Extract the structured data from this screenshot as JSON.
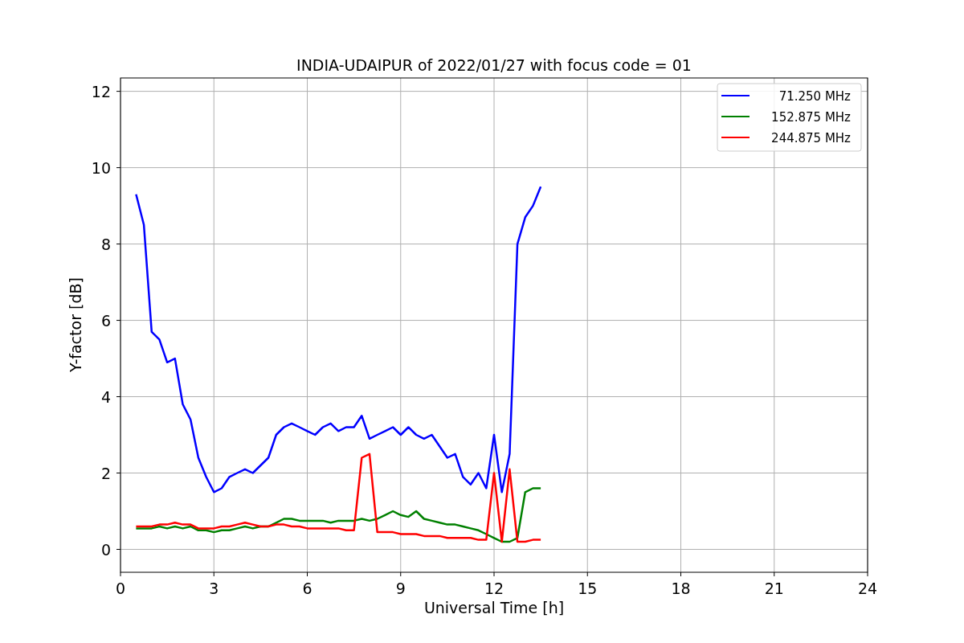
{
  "chart": {
    "chart_data": {
      "type": "line",
      "title": "INDIA-UDAIPUR of 2022/01/27 with focus code = 01",
      "xlabel": "Universal Time [h]",
      "ylabel": "Y-factor [dB]",
      "x": [
        0.5,
        0.75,
        1.0,
        1.25,
        1.5,
        1.75,
        2.0,
        2.25,
        2.5,
        2.75,
        3.0,
        3.25,
        3.5,
        3.75,
        4.0,
        4.25,
        4.5,
        4.75,
        5.0,
        5.25,
        5.5,
        5.75,
        6.0,
        6.25,
        6.5,
        6.75,
        7.0,
        7.25,
        7.5,
        7.75,
        8.0,
        8.25,
        8.5,
        8.75,
        9.0,
        9.25,
        9.5,
        9.75,
        10.0,
        10.25,
        10.5,
        10.75,
        11.0,
        11.25,
        11.5,
        11.75,
        12.0,
        12.25,
        12.5,
        12.75,
        13.0,
        13.25,
        13.5
      ],
      "series": [
        {
          "name": "71.250 MHz",
          "color": "#0000ff",
          "values": [
            9.3,
            8.5,
            5.7,
            5.5,
            4.9,
            5.0,
            3.8,
            3.4,
            2.4,
            1.9,
            1.5,
            1.6,
            1.9,
            2.0,
            2.1,
            2.0,
            2.2,
            2.4,
            3.0,
            3.2,
            3.3,
            3.2,
            3.1,
            3.0,
            3.2,
            3.3,
            3.1,
            3.2,
            3.2,
            3.5,
            2.9,
            3.0,
            3.1,
            3.2,
            3.0,
            3.2,
            3.0,
            2.9,
            3.0,
            2.7,
            2.4,
            2.5,
            1.9,
            1.7,
            2.0,
            1.6,
            3.0,
            1.5,
            2.5,
            8.0,
            8.7,
            9.0,
            9.5
          ]
        },
        {
          "name": "152.875 MHz",
          "color": "#008000",
          "values": [
            0.55,
            0.55,
            0.55,
            0.6,
            0.55,
            0.6,
            0.55,
            0.6,
            0.5,
            0.5,
            0.45,
            0.5,
            0.5,
            0.55,
            0.6,
            0.55,
            0.6,
            0.6,
            0.7,
            0.8,
            0.8,
            0.75,
            0.75,
            0.75,
            0.75,
            0.7,
            0.75,
            0.75,
            0.75,
            0.8,
            0.75,
            0.8,
            0.9,
            1.0,
            0.9,
            0.85,
            1.0,
            0.8,
            0.75,
            0.7,
            0.65,
            0.65,
            0.6,
            0.55,
            0.5,
            0.4,
            0.3,
            0.2,
            0.2,
            0.3,
            1.5,
            1.6,
            1.6
          ]
        },
        {
          "name": "244.875 MHz",
          "color": "#ff0000",
          "values": [
            0.6,
            0.6,
            0.6,
            0.65,
            0.65,
            0.7,
            0.65,
            0.65,
            0.55,
            0.55,
            0.55,
            0.6,
            0.6,
            0.65,
            0.7,
            0.65,
            0.6,
            0.6,
            0.65,
            0.65,
            0.6,
            0.6,
            0.55,
            0.55,
            0.55,
            0.55,
            0.55,
            0.5,
            0.5,
            2.4,
            2.5,
            0.45,
            0.45,
            0.45,
            0.4,
            0.4,
            0.4,
            0.35,
            0.35,
            0.35,
            0.3,
            0.3,
            0.3,
            0.3,
            0.25,
            0.25,
            2.0,
            0.2,
            2.1,
            0.2,
            0.2,
            0.25,
            0.25
          ]
        }
      ],
      "grid": true,
      "legend": true,
      "xlim": [
        0,
        24
      ],
      "ylim": [
        -0.6,
        12.35
      ],
      "xticks": [
        0,
        3,
        6,
        9,
        12,
        15,
        18,
        21,
        24
      ],
      "yticks": [
        0,
        2,
        4,
        6,
        8,
        10,
        12
      ]
    }
  }
}
